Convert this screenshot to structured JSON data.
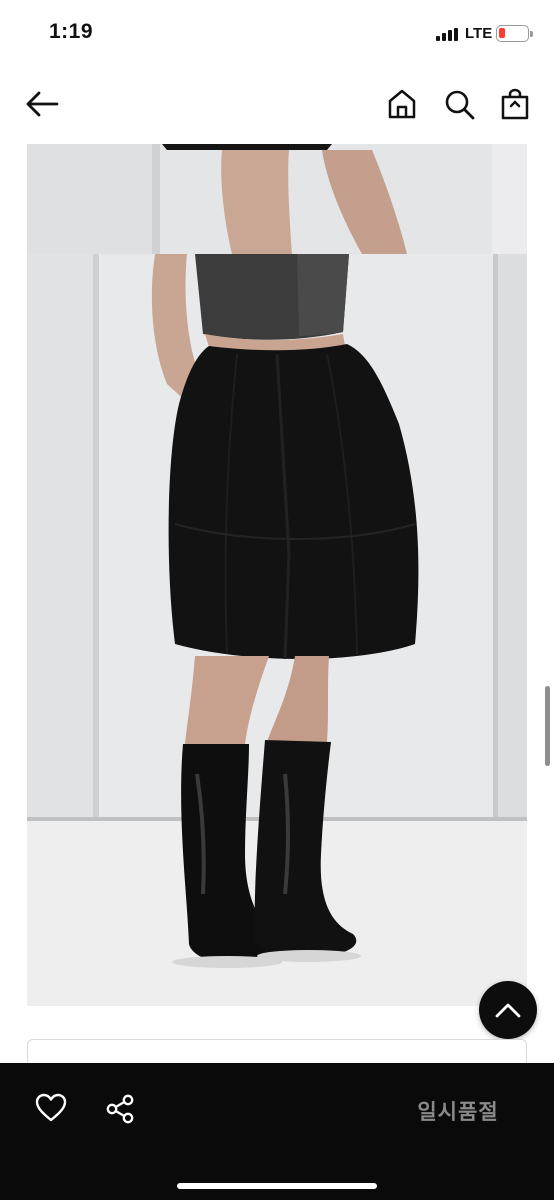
{
  "status_bar": {
    "time": "1:19",
    "network": "LTE",
    "battery_color": "#ff3b30"
  },
  "header": {
    "back_icon": "arrow-left-icon",
    "home_icon": "home-icon",
    "search_icon": "search-icon",
    "bag_icon": "shopping-bag-icon"
  },
  "product_images": [
    {
      "name": "product-photo-partial"
    },
    {
      "name": "product-photo-black-skirt-boots"
    }
  ],
  "floating": {
    "scroll_top_icon": "chevron-up-icon"
  },
  "bottom_bar": {
    "like_icon": "heart-icon",
    "share_icon": "share-icon",
    "status_label": "일시품절",
    "background": "#0a0a0a"
  }
}
